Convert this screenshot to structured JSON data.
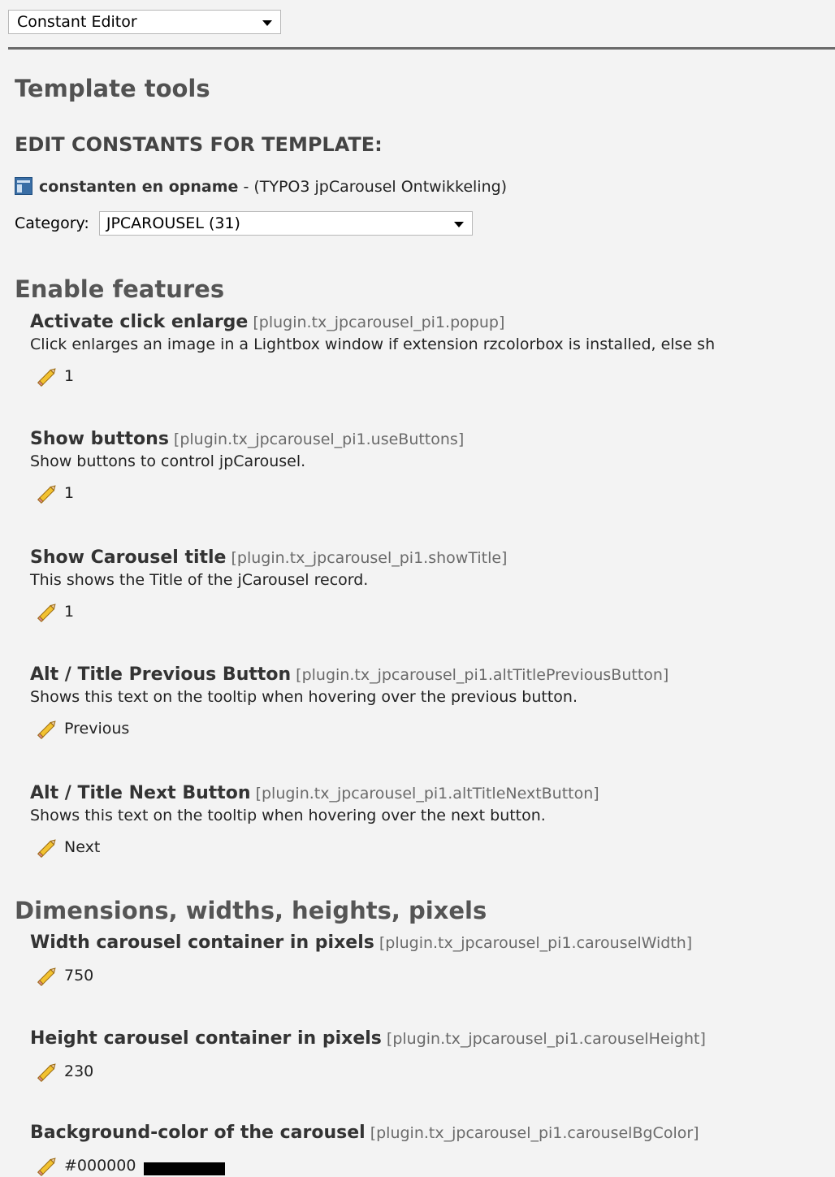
{
  "module_select": {
    "value": "Constant Editor"
  },
  "page_title": "Template tools",
  "subtitle": "EDIT CONSTANTS FOR TEMPLATE:",
  "template": {
    "name": "constanten en opname",
    "rest": " - (TYPO3 jpCarousel Ontwikkeling)",
    "icon": "page-icon"
  },
  "category": {
    "label": "Category:",
    "value": "JPCAROUSEL (31)"
  },
  "sections": [
    {
      "title": "Enable features"
    },
    {
      "title": "Dimensions, widths, heights, pixels"
    }
  ],
  "items": [
    {
      "title": "Activate click enlarge",
      "key": "[plugin.tx_jpcarousel_pi1.popup]",
      "desc": "Click enlarges an image in a Lightbox window if extension rzcolorbox is installed, else sh",
      "value": "1"
    },
    {
      "title": "Show buttons",
      "key": "[plugin.tx_jpcarousel_pi1.useButtons]",
      "desc": "Show buttons to control jpCarousel.",
      "value": "1"
    },
    {
      "title": "Show Carousel title",
      "key": "[plugin.tx_jpcarousel_pi1.showTitle]",
      "desc": "This shows the Title of the jCarousel record.",
      "value": "1"
    },
    {
      "title": "Alt / Title Previous Button",
      "key": "[plugin.tx_jpcarousel_pi1.altTitlePreviousButton]",
      "desc": "Shows this text on the tooltip when hovering over the previous button.",
      "value": "Previous"
    },
    {
      "title": "Alt / Title Next Button",
      "key": "[plugin.tx_jpcarousel_pi1.altTitleNextButton]",
      "desc": "Shows this text on the tooltip when hovering over the next button.",
      "value": "Next"
    },
    {
      "title": "Width carousel container in pixels",
      "key": "[plugin.tx_jpcarousel_pi1.carouselWidth]",
      "value": "750"
    },
    {
      "title": "Height carousel container in pixels",
      "key": "[plugin.tx_jpcarousel_pi1.carouselHeight]",
      "value": "230"
    },
    {
      "title": "Background-color of the carousel",
      "key": "[plugin.tx_jpcarousel_pi1.carouselBgColor]",
      "value": "#000000",
      "swatch_color": "#000000"
    }
  ],
  "colors": {
    "pencil_body": "#f2c230",
    "pencil_outline": "#9a6a10",
    "section_title": "#555555"
  }
}
